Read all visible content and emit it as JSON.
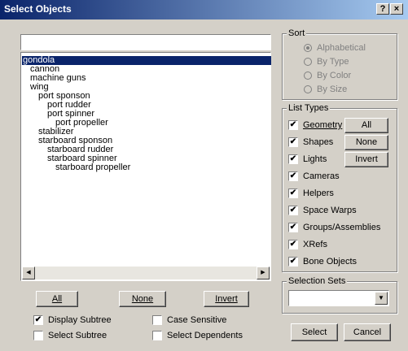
{
  "window": {
    "title": "Select Objects",
    "help_label": "?",
    "close_label": "×"
  },
  "filter": {
    "value": ""
  },
  "tree": {
    "items": [
      {
        "label": "gondola",
        "selected": true
      },
      {
        "label": "cannon"
      },
      {
        "label": "machine guns"
      },
      {
        "label": "wing"
      },
      {
        "label": "port sponson"
      },
      {
        "label": "port rudder"
      },
      {
        "label": "port spinner"
      },
      {
        "label": "port propeller"
      },
      {
        "label": "stabilizer"
      },
      {
        "label": "starboard sponson"
      },
      {
        "label": "starboard rudder"
      },
      {
        "label": "starboard spinner"
      },
      {
        "label": "starboard propeller"
      }
    ]
  },
  "scrollbar": {
    "left_arrow": "◀",
    "right_arrow": "▶"
  },
  "bottom_buttons": {
    "all": "All",
    "none": "None",
    "invert": "Invert"
  },
  "options": {
    "display_subtree": {
      "label": "Display Subtree",
      "checked": true
    },
    "case_sensitive": {
      "label": "Case Sensitive",
      "checked": false
    },
    "select_subtree": {
      "label": "Select Subtree",
      "checked": false
    },
    "select_dependents": {
      "label": "Select Dependents",
      "checked": false
    }
  },
  "sort": {
    "title": "Sort",
    "options": [
      "Alphabetical",
      "By Type",
      "By Color",
      "By Size"
    ],
    "selected": "Alphabetical",
    "enabled": false
  },
  "list_types": {
    "title": "List Types",
    "items": [
      {
        "label": "Geometry",
        "checked": true
      },
      {
        "label": "Shapes",
        "checked": true
      },
      {
        "label": "Lights",
        "checked": true
      },
      {
        "label": "Cameras",
        "checked": true
      },
      {
        "label": "Helpers",
        "checked": true
      },
      {
        "label": "Space Warps",
        "checked": true
      },
      {
        "label": "Groups/Assemblies",
        "checked": true
      },
      {
        "label": "XRefs",
        "checked": true
      },
      {
        "label": "Bone Objects",
        "checked": true
      }
    ],
    "buttons": {
      "all": "All",
      "none": "None",
      "invert": "Invert"
    }
  },
  "selection_sets": {
    "title": "Selection Sets",
    "value": "",
    "arrow": "▼"
  },
  "actions": {
    "select": "Select",
    "cancel": "Cancel"
  },
  "check_glyph": "✔"
}
